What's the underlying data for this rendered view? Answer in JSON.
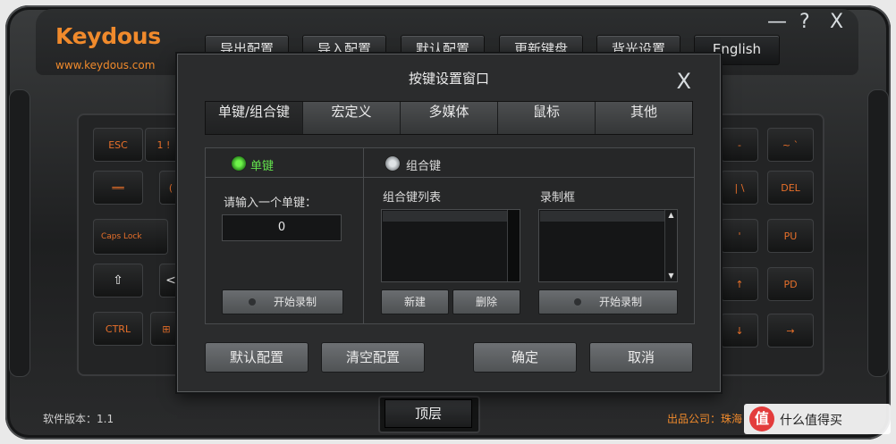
{
  "app": {
    "brand": "Keydous",
    "site": "www.keydous.com",
    "window_controls": {
      "minimize": "—",
      "help": "?",
      "close": "X"
    }
  },
  "toolbar": {
    "export": "导出配置",
    "import": "导入配置",
    "default": "默认配置",
    "update": "更新键盘",
    "backlight": "背光设置",
    "language": "English"
  },
  "keyboard_left": [
    {
      "label": "ESC",
      "style": "orange"
    },
    {
      "label": "1 !",
      "style": "orange"
    },
    {
      "label": "══",
      "style": "orange"
    },
    {
      "label": "(",
      "style": "orange"
    },
    {
      "label": "Caps Lock",
      "style": "orange"
    },
    {
      "label": "⇧",
      "style": "white"
    },
    {
      "label": "<",
      "style": "white"
    },
    {
      "label": "CTRL",
      "style": "orange"
    },
    {
      "label": "⊞",
      "style": "orange"
    }
  ],
  "keyboard_right": [
    {
      "label": "-",
      "style": "orange"
    },
    {
      "label": "~ `",
      "style": "orange"
    },
    {
      "label": "| \\",
      "style": "orange"
    },
    {
      "label": "DEL",
      "style": "orange"
    },
    {
      "label": "'",
      "style": "orange"
    },
    {
      "label": "PU",
      "style": "orange"
    },
    {
      "label": "↑",
      "style": "orange"
    },
    {
      "label": "PD",
      "style": "orange"
    },
    {
      "label": "↓",
      "style": "orange"
    },
    {
      "label": "→",
      "style": "orange"
    }
  ],
  "footer": {
    "version": "软件版本：1.1",
    "company": "出品公司：珠海",
    "bottom_button": "顶层",
    "watermark": "什么值得买"
  },
  "dialog": {
    "title": "按键设置窗口",
    "close": "X",
    "tabs": [
      "单键/组合键",
      "宏定义",
      "多媒体",
      "鼠标",
      "其他"
    ],
    "active_tab": 0,
    "single_key": {
      "radio_label": "单键",
      "prompt": "请输入一个单键：",
      "value": "0",
      "record_button": "开始录制"
    },
    "combo_key": {
      "radio_label": "组合键",
      "list_label": "组合键列表",
      "record_label": "录制框",
      "new_button": "新建",
      "delete_button": "删除",
      "record_button": "开始录制"
    },
    "bottom_buttons": {
      "default": "默认配置",
      "clear": "清空配置",
      "ok": "确定",
      "cancel": "取消"
    }
  },
  "colors": {
    "brand_orange": "#f08a2c",
    "active_green": "#62e04c"
  }
}
